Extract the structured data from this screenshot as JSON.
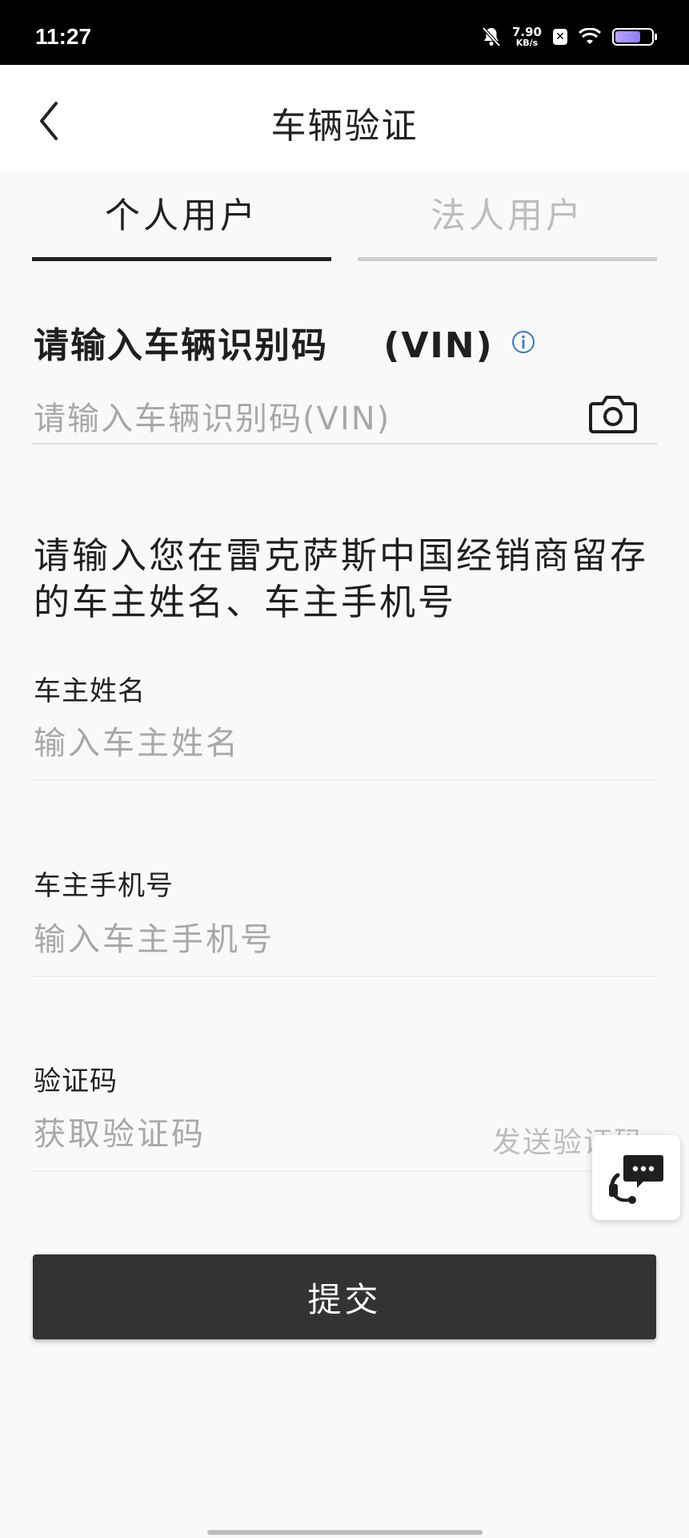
{
  "status": {
    "time": "11:27",
    "net_speed_value": "7.90",
    "net_speed_unit": "KB/s"
  },
  "header": {
    "title": "车辆验证",
    "back_icon": "chevron-left-icon"
  },
  "tabs": [
    {
      "label": "个人用户",
      "active": true
    },
    {
      "label": "法人用户",
      "active": false
    }
  ],
  "vin": {
    "title": "请输入车辆识别码    (VIN)",
    "placeholder": "请输入车辆识别码(VIN)",
    "value": "",
    "info_icon": "info-icon",
    "scan_icon": "camera-icon"
  },
  "instruction": "请输入您在雷克萨斯中国经销商留存的车主姓名、车主手机号",
  "owner_name": {
    "label": "车主姓名",
    "placeholder": "输入车主姓名",
    "value": ""
  },
  "owner_phone": {
    "label": "车主手机号",
    "placeholder": "输入车主手机号",
    "value": ""
  },
  "verify_code": {
    "label": "验证码",
    "placeholder": "获取验证码",
    "value": "",
    "send_label": "发送验证码"
  },
  "submit_label": "提交",
  "floating": {
    "icon": "customer-service-icon"
  },
  "colors": {
    "accent": "#333333",
    "tab_inactive": "#bdbdbd",
    "info_blue": "#3b78c2",
    "background": "#f9f9f9"
  }
}
